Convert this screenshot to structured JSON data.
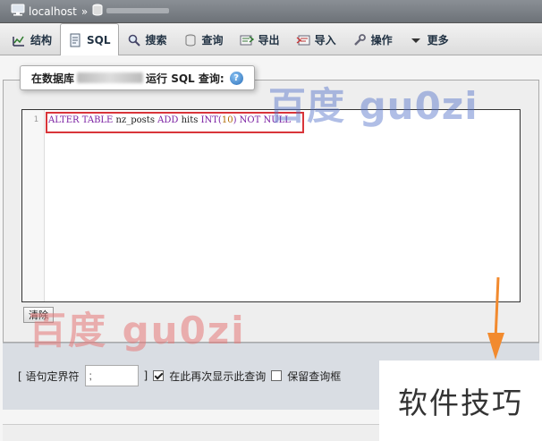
{
  "breadcrumb": {
    "server": "localhost",
    "separator": "»"
  },
  "tabs": [
    {
      "label": "结构",
      "icon": "structure-icon"
    },
    {
      "label": "SQL",
      "icon": "sql-icon"
    },
    {
      "label": "搜索",
      "icon": "search-icon"
    },
    {
      "label": "查询",
      "icon": "query-icon"
    },
    {
      "label": "导出",
      "icon": "export-icon"
    },
    {
      "label": "导入",
      "icon": "import-icon"
    },
    {
      "label": "操作",
      "icon": "wrench-icon"
    },
    {
      "label": "更多",
      "icon": "triangle-down-icon"
    }
  ],
  "query_panel": {
    "legend_prefix": "在数据库",
    "legend_suffix": "运行 SQL 查询:",
    "line_number": "1",
    "sql": {
      "k1": "ALTER TABLE",
      "t1": " nz_posts ",
      "k2": "ADD",
      "t2": " hits ",
      "k3": "INT(",
      "n1": "10",
      "k4": ")",
      "k5": " NOT NULL"
    },
    "clear_label": "清除"
  },
  "options": {
    "delimiter_label": "[ 语句定界符",
    "delimiter_value": ";",
    "delimiter_close": "]",
    "show_again_label": "在此再次显示此查询",
    "show_again_checked": true,
    "retain_label": "保留查询框",
    "retain_checked": false
  },
  "watermarks": {
    "top": "百度 gu0zi",
    "bottom": "百度 gu0zi",
    "corner": "软件技巧"
  },
  "colors": {
    "highlight": "#d9353a",
    "arrow": "#f28a2e"
  }
}
